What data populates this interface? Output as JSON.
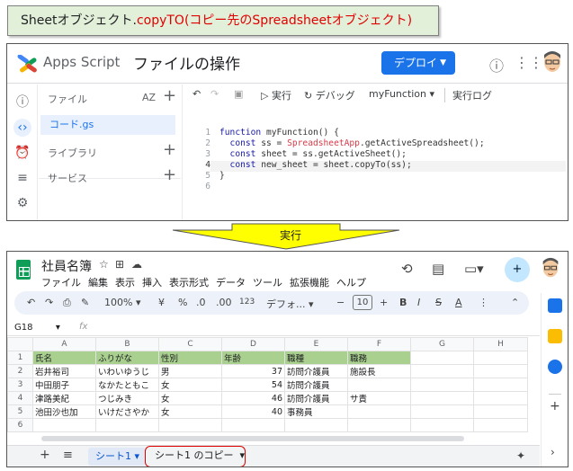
{
  "caption": {
    "pre": "Sheetオブジェクト.",
    "method": "copyTO",
    "post": "(コピー先のSpreadsheetオブジェクト)"
  },
  "apps_script": {
    "brand": "Apps Script",
    "project": "ファイルの操作",
    "deploy_label": "デプロイ",
    "files_label": "ファイル",
    "sort_label": "AZ",
    "file_item": "コード.gs",
    "library_label": "ライブラリ",
    "service_label": "サービス",
    "toolbar": {
      "run": "実行",
      "debug": "デバッグ",
      "function": "myFunction",
      "log": "実行ログ"
    },
    "line_numbers": [
      "1",
      "2",
      "3",
      "4",
      "5",
      "6"
    ],
    "code": {
      "l1_kw": "function",
      "l1_rest": " myFunction() {",
      "l2_kw": "  const",
      "l2_mid": " ss = ",
      "l2_cls": "SpreadsheetApp",
      "l2_rest": ".getActiveSpreadsheet();",
      "l3_kw": "  const",
      "l3_rest": " sheet = ss.getActiveSheet();",
      "l4_kw": "  const",
      "l4_rest": " new_sheet = sheet.copyTo(ss);",
      "l5": "}",
      "l6": ""
    }
  },
  "arrow_label": "実行",
  "sheets": {
    "title": "社員名簿",
    "menu": [
      "ファイル",
      "編集",
      "表示",
      "挿入",
      "表示形式",
      "データ",
      "ツール",
      "拡張機能",
      "ヘルプ"
    ],
    "toolbar": {
      "zoom": "100%",
      "currency": "¥",
      "percent": "%",
      "dec_less": ".0",
      "dec_more": ".00",
      "format_123": "123",
      "font": "デフォ...",
      "font_size": "10",
      "bold": "B",
      "italic": "I",
      "strike": "S",
      "text_color": "A"
    },
    "name_box": "G18",
    "fx": "fx",
    "columns": [
      "A",
      "B",
      "C",
      "D",
      "E",
      "F",
      "G",
      "H"
    ],
    "rows": [
      {
        "n": "1",
        "cells": [
          "氏名",
          "ふりがな",
          "性別",
          "年齢",
          "職種",
          "職務",
          "",
          ""
        ]
      },
      {
        "n": "2",
        "cells": [
          "岩井裕司",
          "いわいゆうじ",
          "男",
          "37",
          "訪問介護員",
          "施設長",
          "",
          ""
        ]
      },
      {
        "n": "3",
        "cells": [
          "中田朋子",
          "なかたともこ",
          "女",
          "54",
          "訪問介護員",
          "",
          "",
          ""
        ]
      },
      {
        "n": "4",
        "cells": [
          "津路美紀",
          "つじみき",
          "女",
          "46",
          "訪問介護員",
          "サ責",
          "",
          ""
        ]
      },
      {
        "n": "5",
        "cells": [
          "池田沙也加",
          "いけださやか",
          "女",
          "40",
          "事務員",
          "",
          "",
          ""
        ]
      },
      {
        "n": "6",
        "cells": [
          "",
          "",
          "",
          "",
          "",
          "",
          "",
          ""
        ]
      }
    ],
    "tabs": {
      "active": "シート1",
      "copy": "シート1 のコピー"
    }
  },
  "colors": {
    "deploy": "#1a73e8",
    "header_row": "#a9d08e",
    "caption_bg": "#e2f0d9",
    "highlight_red": "#e00000",
    "arrow_fill": "#ffff00"
  }
}
